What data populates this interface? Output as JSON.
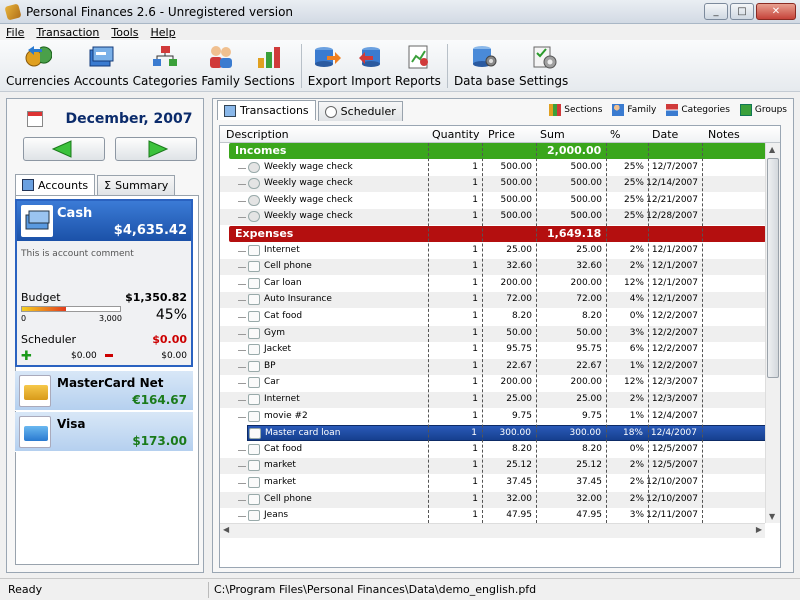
{
  "window": {
    "title": "Personal Finances 2.6 - Unregistered version"
  },
  "menu": [
    "File",
    "Transaction",
    "Tools",
    "Help"
  ],
  "toolbar": [
    {
      "label": "Currencies",
      "icon": "currencies-icon"
    },
    {
      "label": "Accounts",
      "icon": "accounts-icon"
    },
    {
      "label": "Categories",
      "icon": "categories-icon"
    },
    {
      "label": "Family",
      "icon": "family-icon"
    },
    {
      "label": "Sections",
      "icon": "sections-icon"
    },
    {
      "label": "Export",
      "icon": "export-icon"
    },
    {
      "label": "Import",
      "icon": "import-icon"
    },
    {
      "label": "Reports",
      "icon": "reports-icon"
    },
    {
      "label": "Data base",
      "icon": "database-icon"
    },
    {
      "label": "Settings",
      "icon": "settings-icon"
    }
  ],
  "left": {
    "month": "December, 2007",
    "tabs": [
      "Accounts",
      "Summary"
    ],
    "active_account": {
      "name": "Cash",
      "balance": "$4,635.42",
      "comment": "This is account comment",
      "budget_label": "Budget",
      "budget_value": "$1,350.82",
      "budget_min": "0",
      "budget_max": "3,000",
      "budget_percent": "45%",
      "budget_fraction": 0.45,
      "scheduler_label": "Scheduler",
      "scheduler_value": "$0.00",
      "plus_value": "$0.00",
      "minus_value": "$0.00"
    },
    "accounts": [
      {
        "name": "MasterCard Net",
        "balance": "€164.67"
      },
      {
        "name": "Visa",
        "balance": "$173.00"
      }
    ]
  },
  "right": {
    "tabs": [
      "Transactions",
      "Scheduler"
    ],
    "tools": [
      "Sections",
      "Family",
      "Categories",
      "Groups"
    ],
    "columns": [
      "Description",
      "Quantity",
      "Price",
      "Sum",
      "%",
      "Date",
      "Notes"
    ],
    "incomes": {
      "label": "Incomes",
      "total": "2,000.00",
      "color": "#3aa61c"
    },
    "expenses": {
      "label": "Expenses",
      "total": "1,649.18",
      "color": "#b40f0f"
    },
    "income_rows": [
      [
        "Weekly wage check",
        "1",
        "500.00",
        "500.00",
        "25%",
        "12/7/2007"
      ],
      [
        "Weekly wage check",
        "1",
        "500.00",
        "500.00",
        "25%",
        "12/14/2007"
      ],
      [
        "Weekly wage check",
        "1",
        "500.00",
        "500.00",
        "25%",
        "12/21/2007"
      ],
      [
        "Weekly wage check",
        "1",
        "500.00",
        "500.00",
        "25%",
        "12/28/2007"
      ]
    ],
    "expense_rows": [
      [
        "Internet",
        "1",
        "25.00",
        "25.00",
        "2%",
        "12/1/2007"
      ],
      [
        "Cell phone",
        "1",
        "32.60",
        "32.60",
        "2%",
        "12/1/2007"
      ],
      [
        "Car loan",
        "1",
        "200.00",
        "200.00",
        "12%",
        "12/1/2007"
      ],
      [
        "Auto Insurance",
        "1",
        "72.00",
        "72.00",
        "4%",
        "12/1/2007"
      ],
      [
        "Cat food",
        "1",
        "8.20",
        "8.20",
        "0%",
        "12/2/2007"
      ],
      [
        "Gym",
        "1",
        "50.00",
        "50.00",
        "3%",
        "12/2/2007"
      ],
      [
        "Jacket",
        "1",
        "95.75",
        "95.75",
        "6%",
        "12/2/2007"
      ],
      [
        "BP",
        "1",
        "22.67",
        "22.67",
        "1%",
        "12/2/2007"
      ],
      [
        "Car",
        "1",
        "200.00",
        "200.00",
        "12%",
        "12/3/2007"
      ],
      [
        "Internet",
        "1",
        "25.00",
        "25.00",
        "2%",
        "12/3/2007"
      ],
      [
        "movie #2",
        "1",
        "9.75",
        "9.75",
        "1%",
        "12/4/2007"
      ],
      [
        "Master card loan",
        "1",
        "300.00",
        "300.00",
        "18%",
        "12/4/2007"
      ],
      [
        "Cat food",
        "1",
        "8.20",
        "8.20",
        "0%",
        "12/5/2007"
      ],
      [
        "market",
        "1",
        "25.12",
        "25.12",
        "2%",
        "12/5/2007"
      ],
      [
        "market",
        "1",
        "37.45",
        "37.45",
        "2%",
        "12/10/2007"
      ],
      [
        "Cell phone",
        "1",
        "32.00",
        "32.00",
        "2%",
        "12/10/2007"
      ],
      [
        "Jeans",
        "1",
        "47.95",
        "47.95",
        "3%",
        "12/11/2007"
      ]
    ],
    "selected_expense_index": 11
  },
  "status": {
    "left": "Ready",
    "path": "C:\\Program Files\\Personal Finances\\Data\\demo_english.pfd"
  }
}
